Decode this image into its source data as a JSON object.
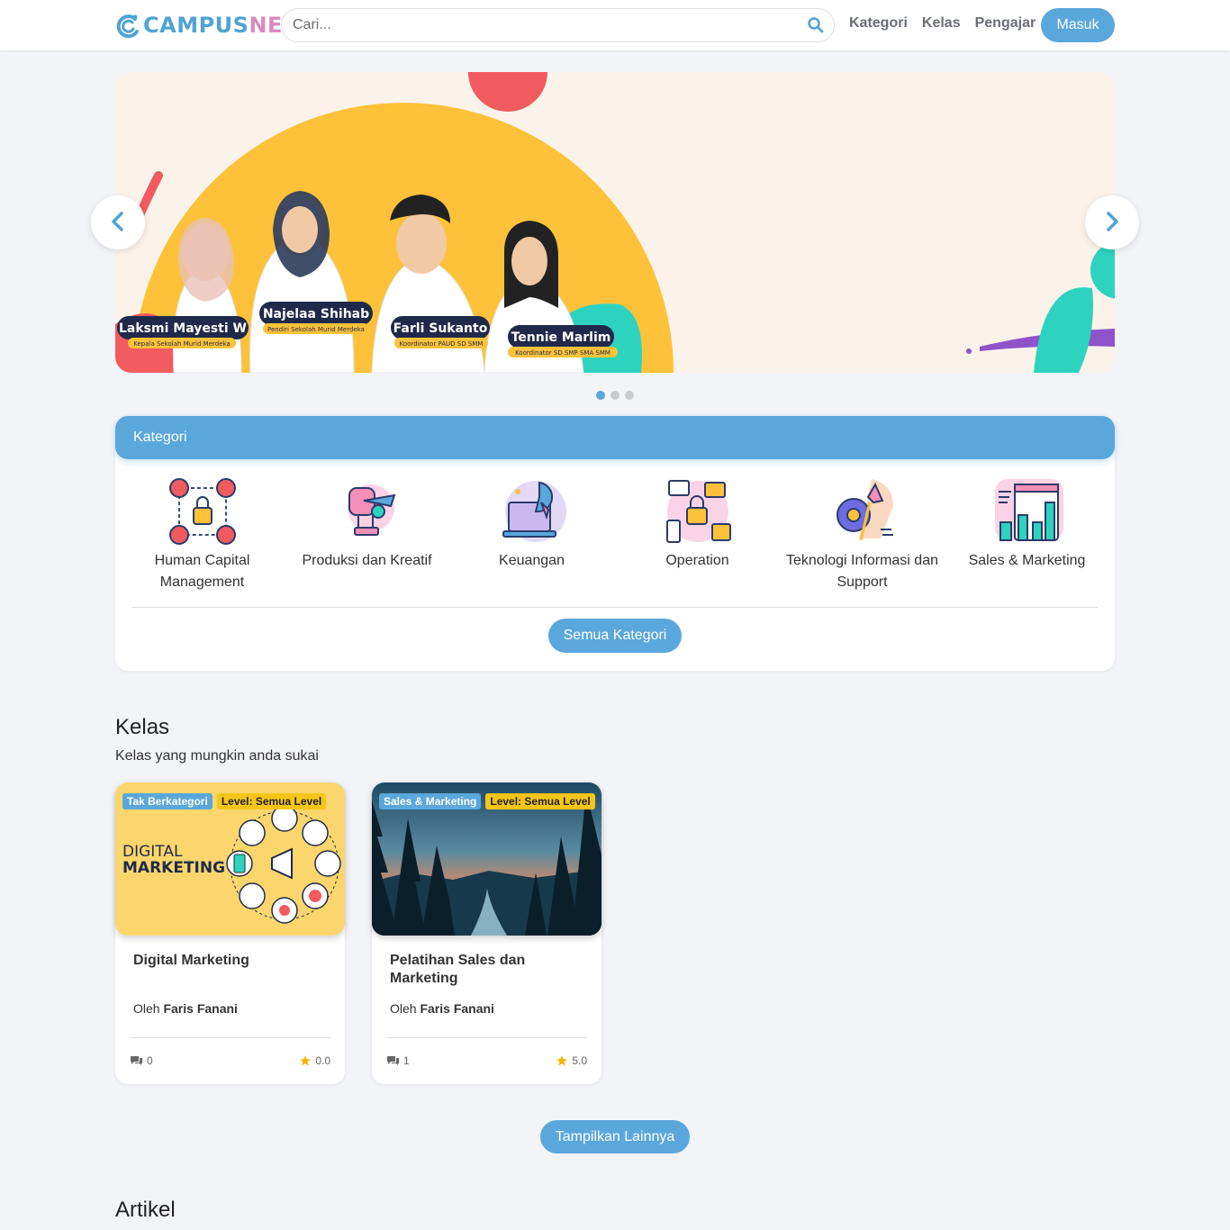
{
  "brand": {
    "part1": "CAMPUS",
    "part2": "NET"
  },
  "search": {
    "placeholder": "Cari..."
  },
  "nav": {
    "links": [
      "Kategori",
      "Kelas",
      "Pengajar"
    ],
    "login": "Masuk"
  },
  "banner": {
    "people": [
      {
        "name": "Laksmi Mayesti W",
        "role": "Kepala Sekolah Murid Merdeka"
      },
      {
        "name": "Najelaa Shihab",
        "role": "Pendiri Sekolah Murid Merdeka"
      },
      {
        "name": "Farli Sukanto",
        "role": "Koordinator PAUD SD SMM"
      },
      {
        "name": "Tennie Marlim",
        "role": "Koordinator SD SMP SMA SMM"
      }
    ],
    "slide_count": 3,
    "active_slide": 1
  },
  "categories": {
    "header": "Kategori",
    "items": [
      {
        "label": "Human Capital Management",
        "icon": "human-capital-icon"
      },
      {
        "label": "Produksi dan Kreatif",
        "icon": "creative-production-icon"
      },
      {
        "label": "Keuangan",
        "icon": "finance-icon"
      },
      {
        "label": "Operation",
        "icon": "operation-icon"
      },
      {
        "label": "Teknologi Informasi dan Support",
        "icon": "it-support-icon"
      },
      {
        "label": "Sales & Marketing",
        "icon": "sales-marketing-icon"
      }
    ],
    "all_button": "Semua Kategori"
  },
  "kelas": {
    "title": "Kelas",
    "subtitle": "Kelas yang mungkin anda sukai",
    "courses": [
      {
        "category": "Tak Berkategori",
        "level": "Level: Semua Level",
        "thumb_text_1": "DIGITAL",
        "thumb_text_2": "MARKETING",
        "title": "Digital Marketing",
        "by": "Oleh",
        "author": "Faris Fanani",
        "comments": "0",
        "rating": "0.0"
      },
      {
        "category": "Sales & Marketing",
        "level": "Level: Semua Level",
        "title": "Pelatihan Sales dan Marketing",
        "by": "Oleh",
        "author": "Faris Fanani",
        "comments": "1",
        "rating": "5.0"
      }
    ],
    "more_button": "Tampilkan Lainnya"
  },
  "artikel": {
    "title": "Artikel"
  },
  "colors": {
    "accent": "#5aa7dc",
    "badge_yellow": "#f5c518",
    "star": "#f5b400"
  }
}
